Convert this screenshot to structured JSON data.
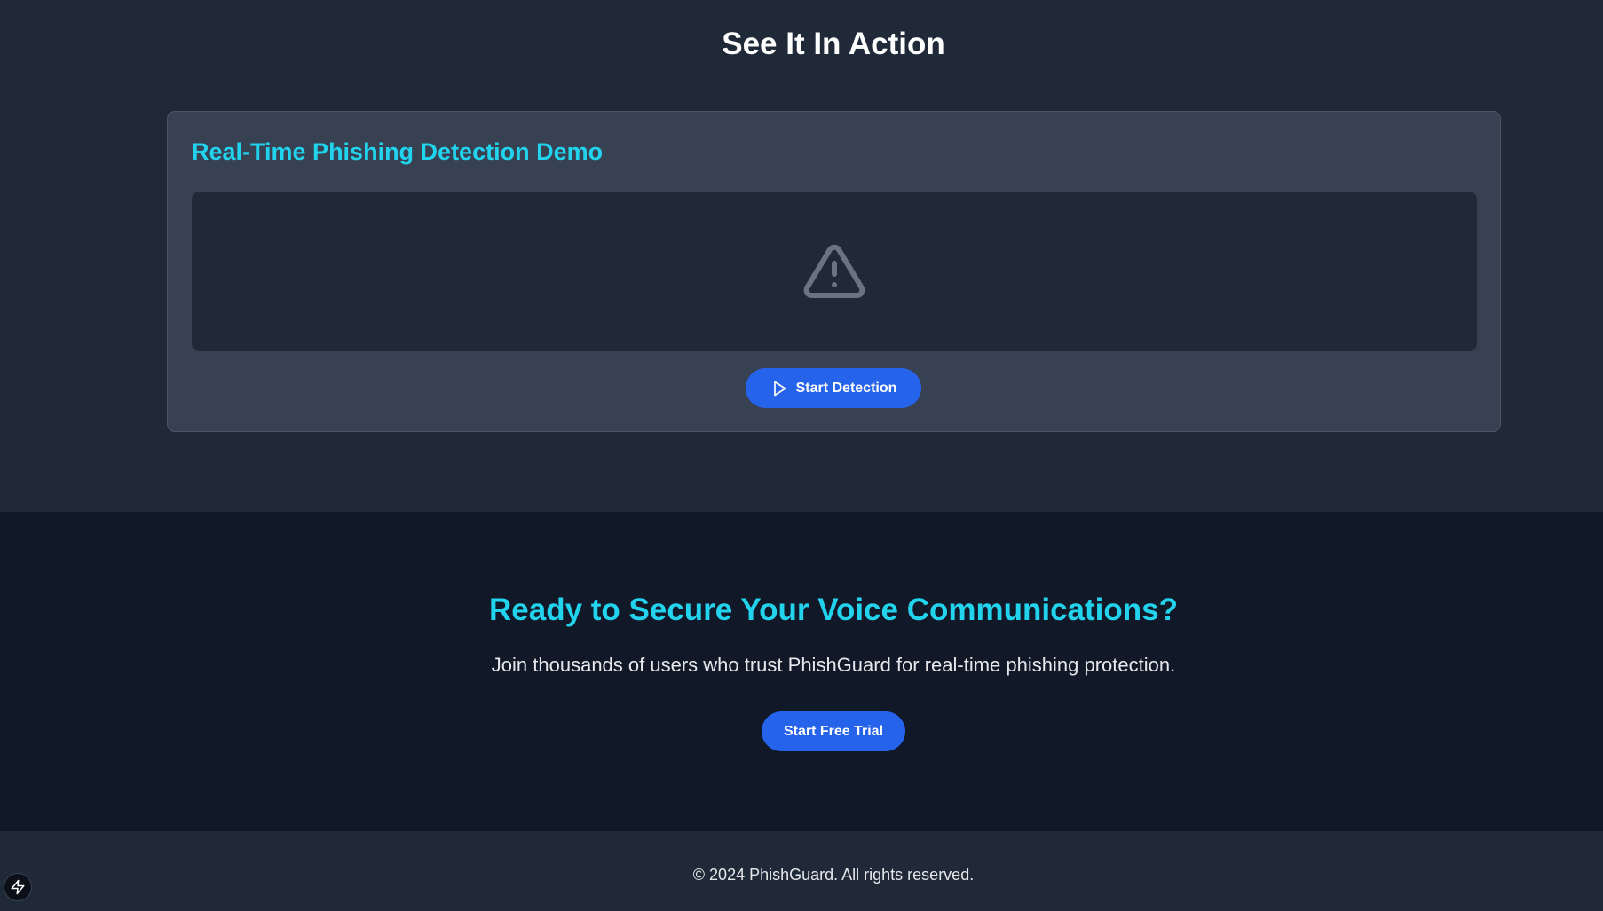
{
  "demo": {
    "section_title": "See It In Action",
    "card_title": "Real-Time Phishing Detection Demo",
    "screen_icon": "warning-triangle-icon",
    "start_button_label": "Start Detection",
    "start_button_icon": "play-icon"
  },
  "cta": {
    "title": "Ready to Secure Your Voice Communications?",
    "text": "Join thousands of users who trust PhishGuard for real-time phishing protection.",
    "button_label": "Start Free Trial"
  },
  "footer": {
    "copyright": "© 2024 PhishGuard. All rights reserved."
  },
  "dev_badge_icon": "lightning-bolt-icon",
  "colors": {
    "accent": "#22d3ee",
    "button": "#2563eb",
    "page_bg": "#1f2937",
    "card_bg": "#374151",
    "cta_bg": "#111827"
  }
}
